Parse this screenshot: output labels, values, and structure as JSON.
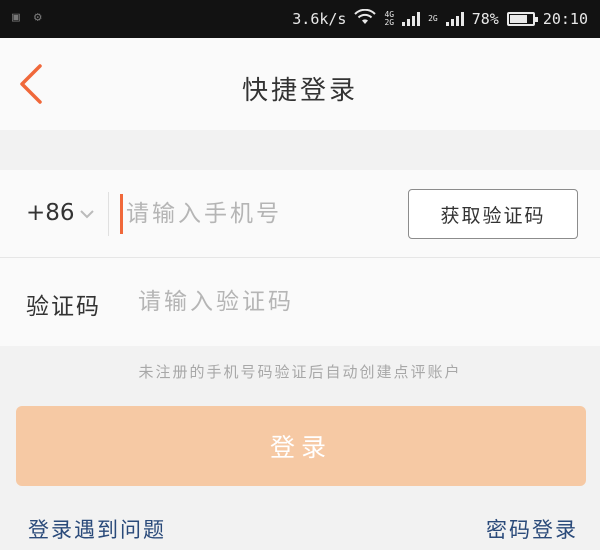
{
  "status_bar": {
    "net_speed": "3.6k/s",
    "net_tag_top": "4G",
    "net_tag_bottom": "2G",
    "sim2_tag": "2G",
    "battery": "78%",
    "battery_level": 0.78,
    "time": "20:10",
    "left_icons": [
      "photo-notification-icon",
      "settings-notification-icon"
    ]
  },
  "header": {
    "back_icon": "chevron-left-icon",
    "title": "快捷登录"
  },
  "form": {
    "country_code": "+86",
    "phone_placeholder": "请输入手机号",
    "get_code_label": "获取验证码",
    "code_label": "验证码",
    "code_placeholder": "请输入验证码"
  },
  "hint": "未注册的手机号码验证后自动创建点评账户",
  "login_button": "登录",
  "links": {
    "problem": "登录遇到问题",
    "password_login": "密码登录"
  },
  "colors": {
    "accent": "#f0683a",
    "login_button_bg": "#f6c9a4",
    "link": "#2a4a7a"
  }
}
